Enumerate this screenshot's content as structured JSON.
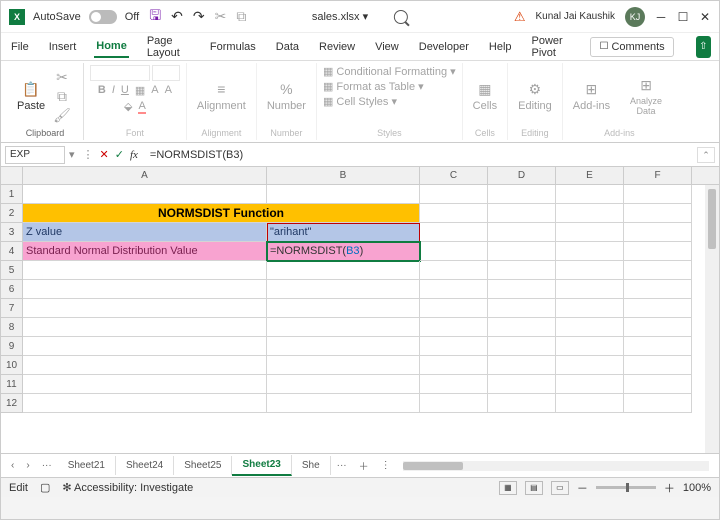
{
  "title": {
    "autosave": "AutoSave",
    "autosave_state": "Off",
    "filename": "sales.xlsx ▾",
    "user_name": "Kunal Jai Kaushik",
    "user_initials": "KJ"
  },
  "tabs": {
    "file": "File",
    "insert": "Insert",
    "home": "Home",
    "page": "Page Layout",
    "formulas": "Formulas",
    "data": "Data",
    "review": "Review",
    "view": "View",
    "developer": "Developer",
    "help": "Help",
    "power": "Power Pivot",
    "comments": "Comments"
  },
  "ribbon": {
    "clipboard": "Clipboard",
    "paste": "Paste",
    "font": "Font",
    "alignment": "Alignment",
    "number": "Number",
    "styles": "Styles",
    "cells": "Cells",
    "editing": "Editing",
    "addins": "Add-ins",
    "analyze": "Analyze Data",
    "cond": "Conditional Formatting ▾",
    "table": "Format as Table ▾",
    "cellstyles": "Cell Styles ▾",
    "addins_btn": "Add-ins",
    "b": "B",
    "i": "I",
    "u": "U"
  },
  "formula": {
    "name": "EXP",
    "value": "=NORMSDIST(B3)"
  },
  "cols": {
    "A": "A",
    "B": "B",
    "C": "C",
    "D": "D",
    "E": "E",
    "F": "F"
  },
  "rows": [
    "1",
    "2",
    "3",
    "4",
    "5",
    "6",
    "7",
    "8",
    "9",
    "10",
    "11",
    "12"
  ],
  "cells": {
    "r2": "NORMSDIST Function",
    "r3a": "Z value",
    "r3b": "\"arihant\"",
    "r4a": "Standard Normal Distribution Value",
    "r4b_pre": "=NORMSDIST(",
    "r4b_ref": "B3",
    "r4b_post": ")"
  },
  "sheets": {
    "s21": "Sheet21",
    "s24": "Sheet24",
    "s25": "Sheet25",
    "s23": "Sheet23",
    "more1": "She",
    "dots": "···"
  },
  "status": {
    "mode": "Edit",
    "access": "Accessibility: Investigate",
    "zoom": "100%",
    "plus": "＋",
    "minus": "－"
  }
}
